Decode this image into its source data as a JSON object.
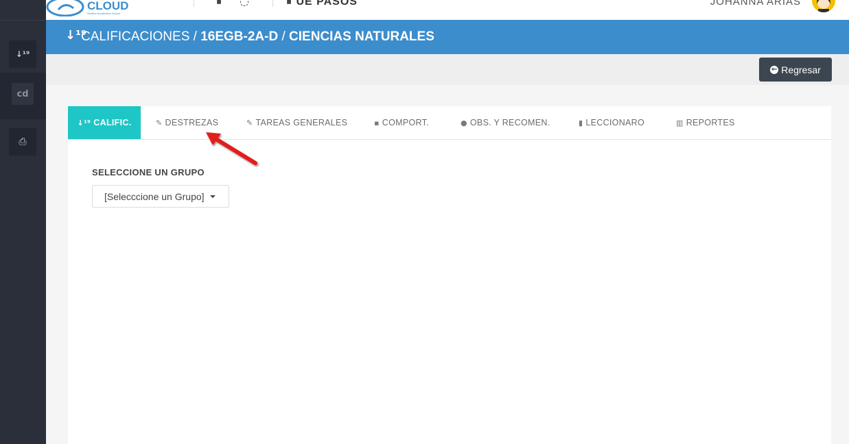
{
  "header": {
    "logo_text": "CLOUD",
    "logo_subtitle": "Gestion Académica OnLine",
    "menu_label": "UE PASOS",
    "user_name": "JOHANNA ARIAS"
  },
  "sidebar": {
    "items": [
      {
        "icon": "sort-numeric-icon",
        "glyph": "↓¹⁹"
      },
      {
        "icon": "cd-logo",
        "glyph": "cd"
      },
      {
        "icon": "print-icon",
        "glyph": "⎙"
      }
    ]
  },
  "title": {
    "icon_glyph": "↓¹⁹",
    "section": "CALIFICACIONES",
    "separator1": "/",
    "course": "16EGB-2A-D",
    "separator2": "/",
    "subject": "CIENCIAS NATURALES"
  },
  "actions": {
    "back_label": "Regresar"
  },
  "tabs": [
    {
      "label": "CALIFIC.",
      "icon": "sort-numeric-icon",
      "glyph": "↓¹⁹",
      "active": true
    },
    {
      "label": "DESTREZAS",
      "icon": "edit-icon",
      "glyph": "✎",
      "active": false
    },
    {
      "label": "TAREAS GENERALES",
      "icon": "edit-icon",
      "glyph": "✎",
      "active": false
    },
    {
      "label": "COMPORT.",
      "icon": "comment-icon",
      "glyph": "▪",
      "active": false
    },
    {
      "label": "OBS. Y RECOMEN.",
      "icon": "comments-icon",
      "glyph": "●",
      "active": false
    },
    {
      "label": "LECCIONARO",
      "icon": "book-icon",
      "glyph": "▮",
      "active": false
    },
    {
      "label": "REPORTES",
      "icon": "bar-chart-icon",
      "glyph": "▥",
      "active": false
    }
  ],
  "group": {
    "label": "SELECCIONE UN GRUPO",
    "selected": "[Selecccione un Grupo]"
  },
  "colors": {
    "title_bar": "#3c8dcc",
    "active_tab": "#1ec6c6",
    "sidebar": "#2b2f3a",
    "annotation_arrow": "#e41a1a"
  }
}
